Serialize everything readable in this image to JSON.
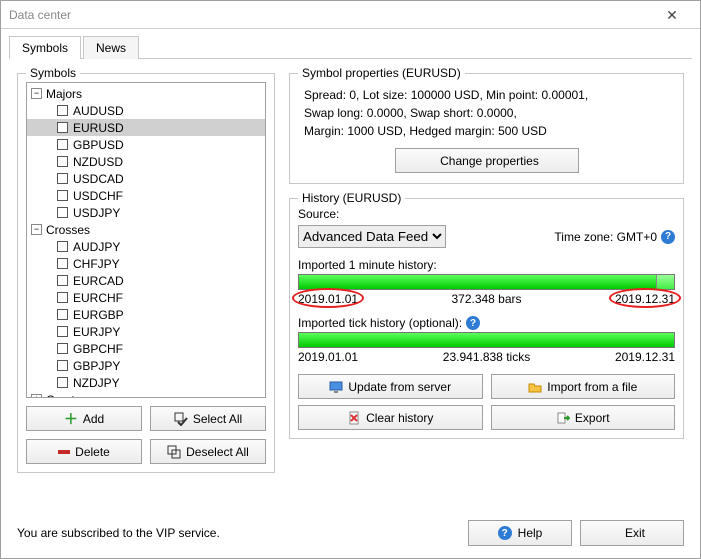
{
  "window": {
    "title": "Data center"
  },
  "tabs": {
    "symbols": "Symbols",
    "news": "News"
  },
  "symbols_panel": {
    "legend": "Symbols",
    "groups": [
      {
        "name": "Majors",
        "expanded": true,
        "items": [
          "AUDUSD",
          "EURUSD",
          "GBPUSD",
          "NZDUSD",
          "USDCAD",
          "USDCHF",
          "USDJPY"
        ],
        "selected": "EURUSD"
      },
      {
        "name": "Crosses",
        "expanded": true,
        "items": [
          "AUDJPY",
          "CHFJPY",
          "EURCAD",
          "EURCHF",
          "EURGBP",
          "EURJPY",
          "GBPCHF",
          "GBPJPY",
          "NZDJPY"
        ]
      },
      {
        "name": "Crypto",
        "expanded": false,
        "items": []
      }
    ],
    "buttons": {
      "add": "Add",
      "select_all": "Select All",
      "delete": "Delete",
      "deselect_all": "Deselect All"
    }
  },
  "properties_panel": {
    "legend": "Symbol properties (EURUSD)",
    "line1": "Spread: 0, Lot size: 100000 USD, Min point: 0.00001,",
    "line2": "Swap long: 0.0000, Swap short: 0.0000,",
    "line3": "Margin: 1000 USD, Hedged margin: 500 USD",
    "change_btn": "Change properties"
  },
  "history_panel": {
    "legend": "History (EURUSD)",
    "source_label": "Source:",
    "source_value": "Advanced Data Feed",
    "timezone_label": "Time zone: GMT+0",
    "minute_label": "Imported 1 minute history:",
    "minute_from": "2019.01.01",
    "minute_bars": "372.348 bars",
    "minute_to": "2019.12.31",
    "tick_label": "Imported tick history (optional):",
    "tick_from": "2019.01.01",
    "tick_bars": "23.941.838 ticks",
    "tick_to": "2019.12.31",
    "buttons": {
      "update": "Update from server",
      "import": "Import from a file",
      "clear": "Clear history",
      "export": "Export"
    }
  },
  "footer": {
    "vip": "You are subscribed to the VIP service.",
    "help": "Help",
    "exit": "Exit"
  }
}
